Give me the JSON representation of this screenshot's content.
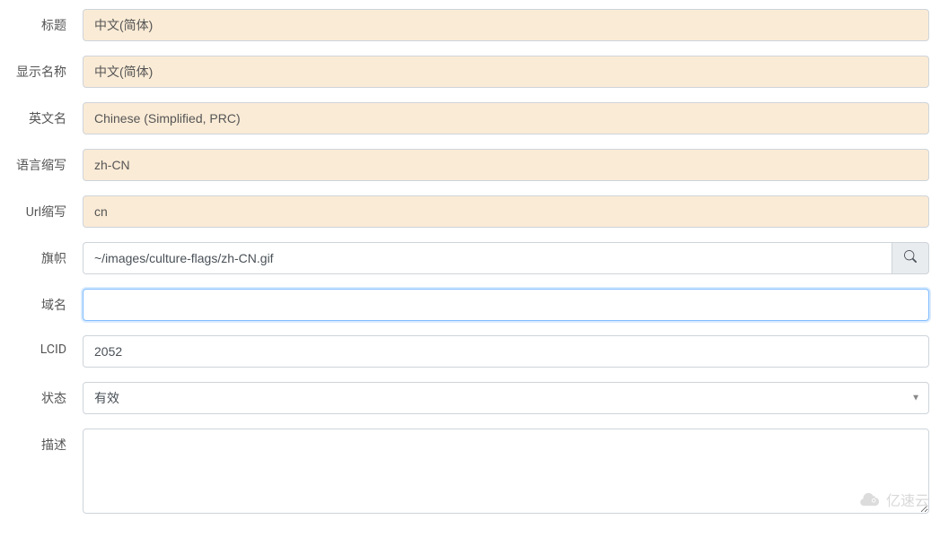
{
  "labels": {
    "title": "标题",
    "displayName": "显示名称",
    "englishName": "英文名",
    "languageAbbr": "语言缩写",
    "urlAbbr": "Url缩写",
    "flag": "旗帜",
    "domain": "域名",
    "lcid": "LCID",
    "status": "状态",
    "description": "描述"
  },
  "values": {
    "title": "中文(简体)",
    "displayName": "中文(简体)",
    "englishName": "Chinese (Simplified, PRC)",
    "languageAbbr": "zh-CN",
    "urlAbbr": "cn",
    "flag": "~/images/culture-flags/zh-CN.gif",
    "domain": "",
    "lcid": "2052",
    "status": "有效",
    "description": ""
  },
  "watermark": "亿速云"
}
